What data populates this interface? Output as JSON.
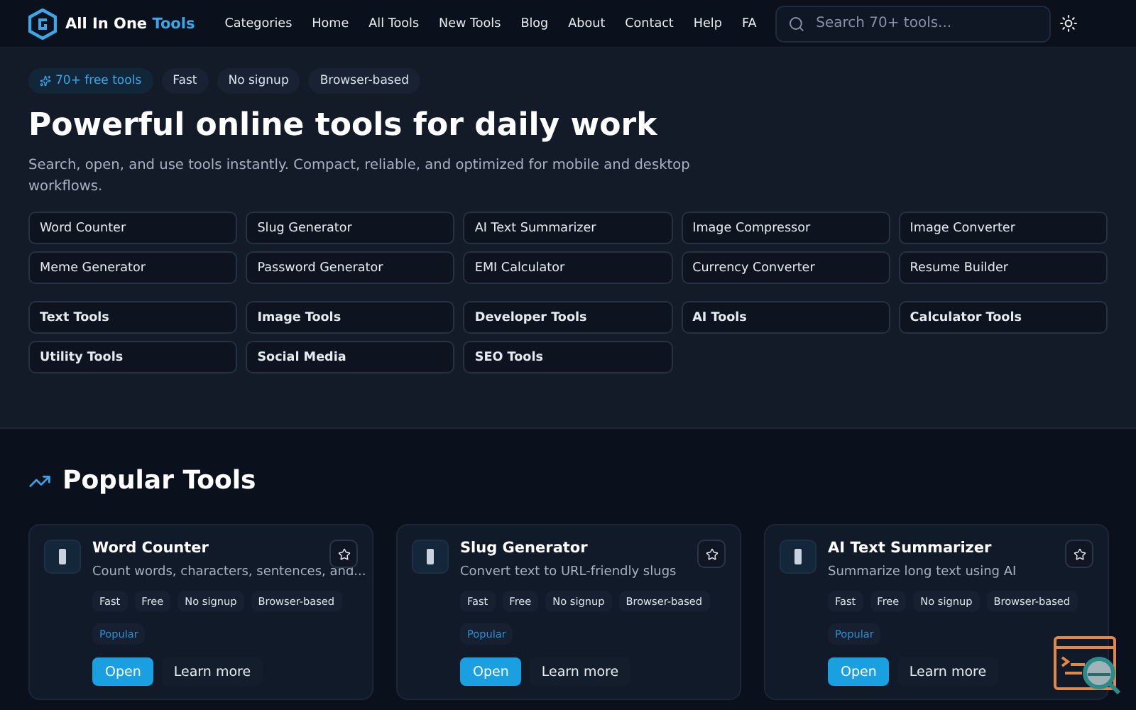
{
  "header": {
    "brand": {
      "name": "All In One",
      "accent": "Tools"
    },
    "nav": [
      {
        "label": "Categories"
      },
      {
        "label": "Home"
      },
      {
        "label": "All Tools"
      },
      {
        "label": "New Tools"
      },
      {
        "label": "Blog"
      },
      {
        "label": "About"
      },
      {
        "label": "Contact"
      },
      {
        "label": "Help"
      },
      {
        "label": "FA"
      }
    ],
    "search": {
      "placeholder": "Search 70+ tools..."
    }
  },
  "hero": {
    "badges": [
      {
        "label": "70+ free tools",
        "kind": "accent"
      },
      {
        "label": "Fast",
        "kind": "plain"
      },
      {
        "label": "No signup",
        "kind": "plain"
      },
      {
        "label": "Browser-based",
        "kind": "plain"
      }
    ],
    "title": "Powerful online tools for daily work",
    "subtitle": "Search, open, and use tools instantly. Compact, reliable, and optimized for mobile and desktop workflows.",
    "quick_links": [
      "Word Counter",
      "Slug Generator",
      "AI Text Summarizer",
      "Image Compressor",
      "Image Converter",
      "Meme Generator",
      "Password Generator",
      "EMI Calculator",
      "Currency Converter",
      "Resume Builder"
    ],
    "categories": [
      "Text Tools",
      "Image Tools",
      "Developer Tools",
      "AI Tools",
      "Calculator Tools",
      "Utility Tools",
      "Social Media",
      "SEO Tools"
    ]
  },
  "popular": {
    "title": "Popular Tools",
    "cards": [
      {
        "name": "Word Counter",
        "description": "Count words, characters, sentences, and...",
        "tags": [
          "Fast",
          "Free",
          "No signup",
          "Browser-based"
        ],
        "badge": "Popular",
        "open": "Open",
        "more": "Learn more"
      },
      {
        "name": "Slug Generator",
        "description": "Convert text to URL-friendly slugs",
        "tags": [
          "Fast",
          "Free",
          "No signup",
          "Browser-based"
        ],
        "badge": "Popular",
        "open": "Open",
        "more": "Learn more"
      },
      {
        "name": "AI Text Summarizer",
        "description": "Summarize long text using AI",
        "tags": [
          "Fast",
          "Free",
          "No signup",
          "Browser-based"
        ],
        "badge": "Popular",
        "open": "Open",
        "more": "Learn more"
      }
    ]
  }
}
